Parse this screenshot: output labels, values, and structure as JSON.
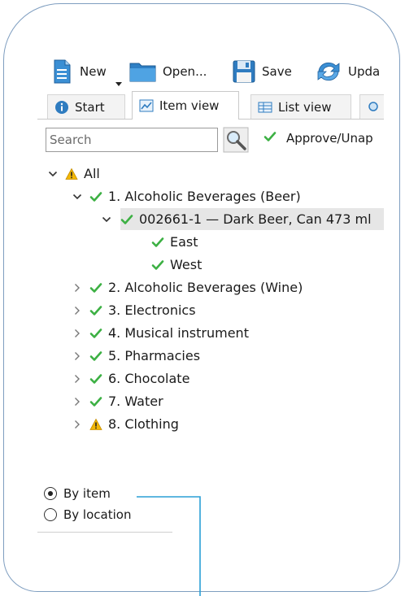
{
  "toolbar": {
    "new_label": "New",
    "open_label": "Open...",
    "save_label": "Save",
    "update_label": "Upda"
  },
  "tabs": [
    {
      "label": "Start",
      "icon": "info-icon"
    },
    {
      "label": "Item view",
      "icon": "chart-icon"
    },
    {
      "label": "List view",
      "icon": "table-icon"
    }
  ],
  "search": {
    "placeholder": "Search",
    "value": ""
  },
  "approve_label": "Approve/Unap",
  "tree": {
    "root": {
      "label": "All",
      "status": "warning"
    },
    "items": [
      {
        "label": "1. Alcoholic Beverages (Beer)",
        "status": "ok",
        "expanded": true,
        "children": [
          {
            "label": "002661-1 — Dark Beer, Can 473 ml",
            "status": "ok",
            "expanded": true,
            "selected": true,
            "children": [
              {
                "label": "East",
                "status": "ok"
              },
              {
                "label": "West",
                "status": "ok"
              }
            ]
          }
        ]
      },
      {
        "label": "2. Alcoholic Beverages (Wine)",
        "status": "ok"
      },
      {
        "label": "3. Electronics",
        "status": "ok"
      },
      {
        "label": "4. Musical instrument",
        "status": "ok"
      },
      {
        "label": "5. Pharmacies",
        "status": "ok"
      },
      {
        "label": "6. Chocolate",
        "status": "ok"
      },
      {
        "label": "7. Water",
        "status": "ok"
      },
      {
        "label": "8. Clothing",
        "status": "warning"
      }
    ]
  },
  "view_mode": {
    "options": [
      "By item",
      "By location"
    ],
    "selected": "By item"
  },
  "colors": {
    "ok_check": "#3cb043",
    "warning": "#f2b705",
    "frame": "#7f9ec0",
    "callout": "#2a9fd6",
    "selection": "#e6e6e6"
  }
}
